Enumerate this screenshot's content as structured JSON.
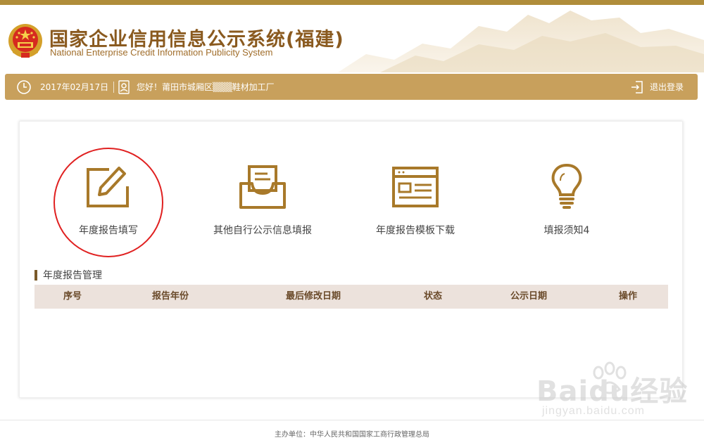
{
  "header": {
    "title_cn": "国家企业信用信息公示系统(福建)",
    "title_en": "National Enterprise Credit Information Publicity System"
  },
  "infobar": {
    "date": "2017年02月17日",
    "greeting": "您好！莆田市城厢区▒▒▒鞋材加工厂",
    "logout": "退出登录"
  },
  "actions": [
    {
      "label": "年度报告填写",
      "icon": "edit-icon",
      "highlighted": true
    },
    {
      "label": "其他自行公示信息填报",
      "icon": "inbox-icon",
      "highlighted": false
    },
    {
      "label": "年度报告模板下载",
      "icon": "template-icon",
      "highlighted": false
    },
    {
      "label": "填报须知4",
      "icon": "lightbulb-icon",
      "highlighted": false
    }
  ],
  "section": {
    "title": "年度报告管理"
  },
  "table": {
    "columns": [
      "序号",
      "报告年份",
      "最后修改日期",
      "状态",
      "公示日期",
      "操作"
    ],
    "rows": []
  },
  "footer": {
    "text": "主办单位：中华人民共和国国家工商行政管理总局"
  },
  "watermark": {
    "main": "Baidu经验",
    "sub": "jingyan.baidu.com"
  },
  "colors": {
    "accent": "#c8a05c",
    "brand_text": "#8a5a1f",
    "icon": "#a8792a",
    "highlight": "#e02020"
  }
}
